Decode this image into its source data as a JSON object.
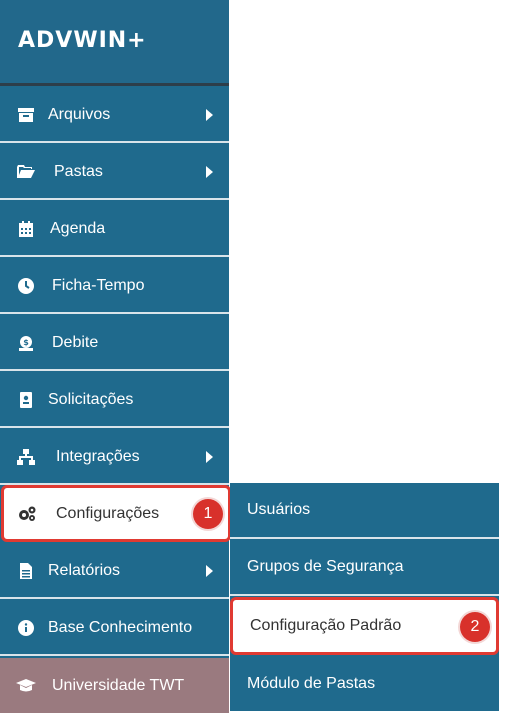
{
  "brand": {
    "logo_text": "ADVWIN+"
  },
  "sidebar": {
    "items": [
      {
        "label": "Arquivos",
        "icon": "archive-icon"
      },
      {
        "label": "Pastas",
        "icon": "folder-open-icon"
      },
      {
        "label": "Agenda",
        "icon": "calendar-icon"
      },
      {
        "label": "Ficha-Tempo",
        "icon": "clock-icon"
      },
      {
        "label": "Debite",
        "icon": "money-icon"
      },
      {
        "label": "Solicitações",
        "icon": "id-card-icon"
      },
      {
        "label": "Integrações",
        "icon": "sitemap-icon"
      },
      {
        "label": "Configurações",
        "icon": "gears-icon"
      },
      {
        "label": "Relatórios",
        "icon": "document-icon"
      },
      {
        "label": "Base Conhecimento",
        "icon": "info-icon"
      },
      {
        "label": "Universidade TWT",
        "icon": "graduation-cap-icon"
      }
    ]
  },
  "submenu": {
    "items": [
      {
        "label": "Usuários"
      },
      {
        "label": "Grupos de Segurança"
      },
      {
        "label": "Configuração Padrão"
      },
      {
        "label": "Módulo de Pastas"
      }
    ]
  },
  "annotations": {
    "badge1": "1",
    "badge2": "2"
  },
  "colors": {
    "sidebar": "#1f6a8d",
    "highlight": "#e03a32",
    "university": "#9a7a7f"
  }
}
